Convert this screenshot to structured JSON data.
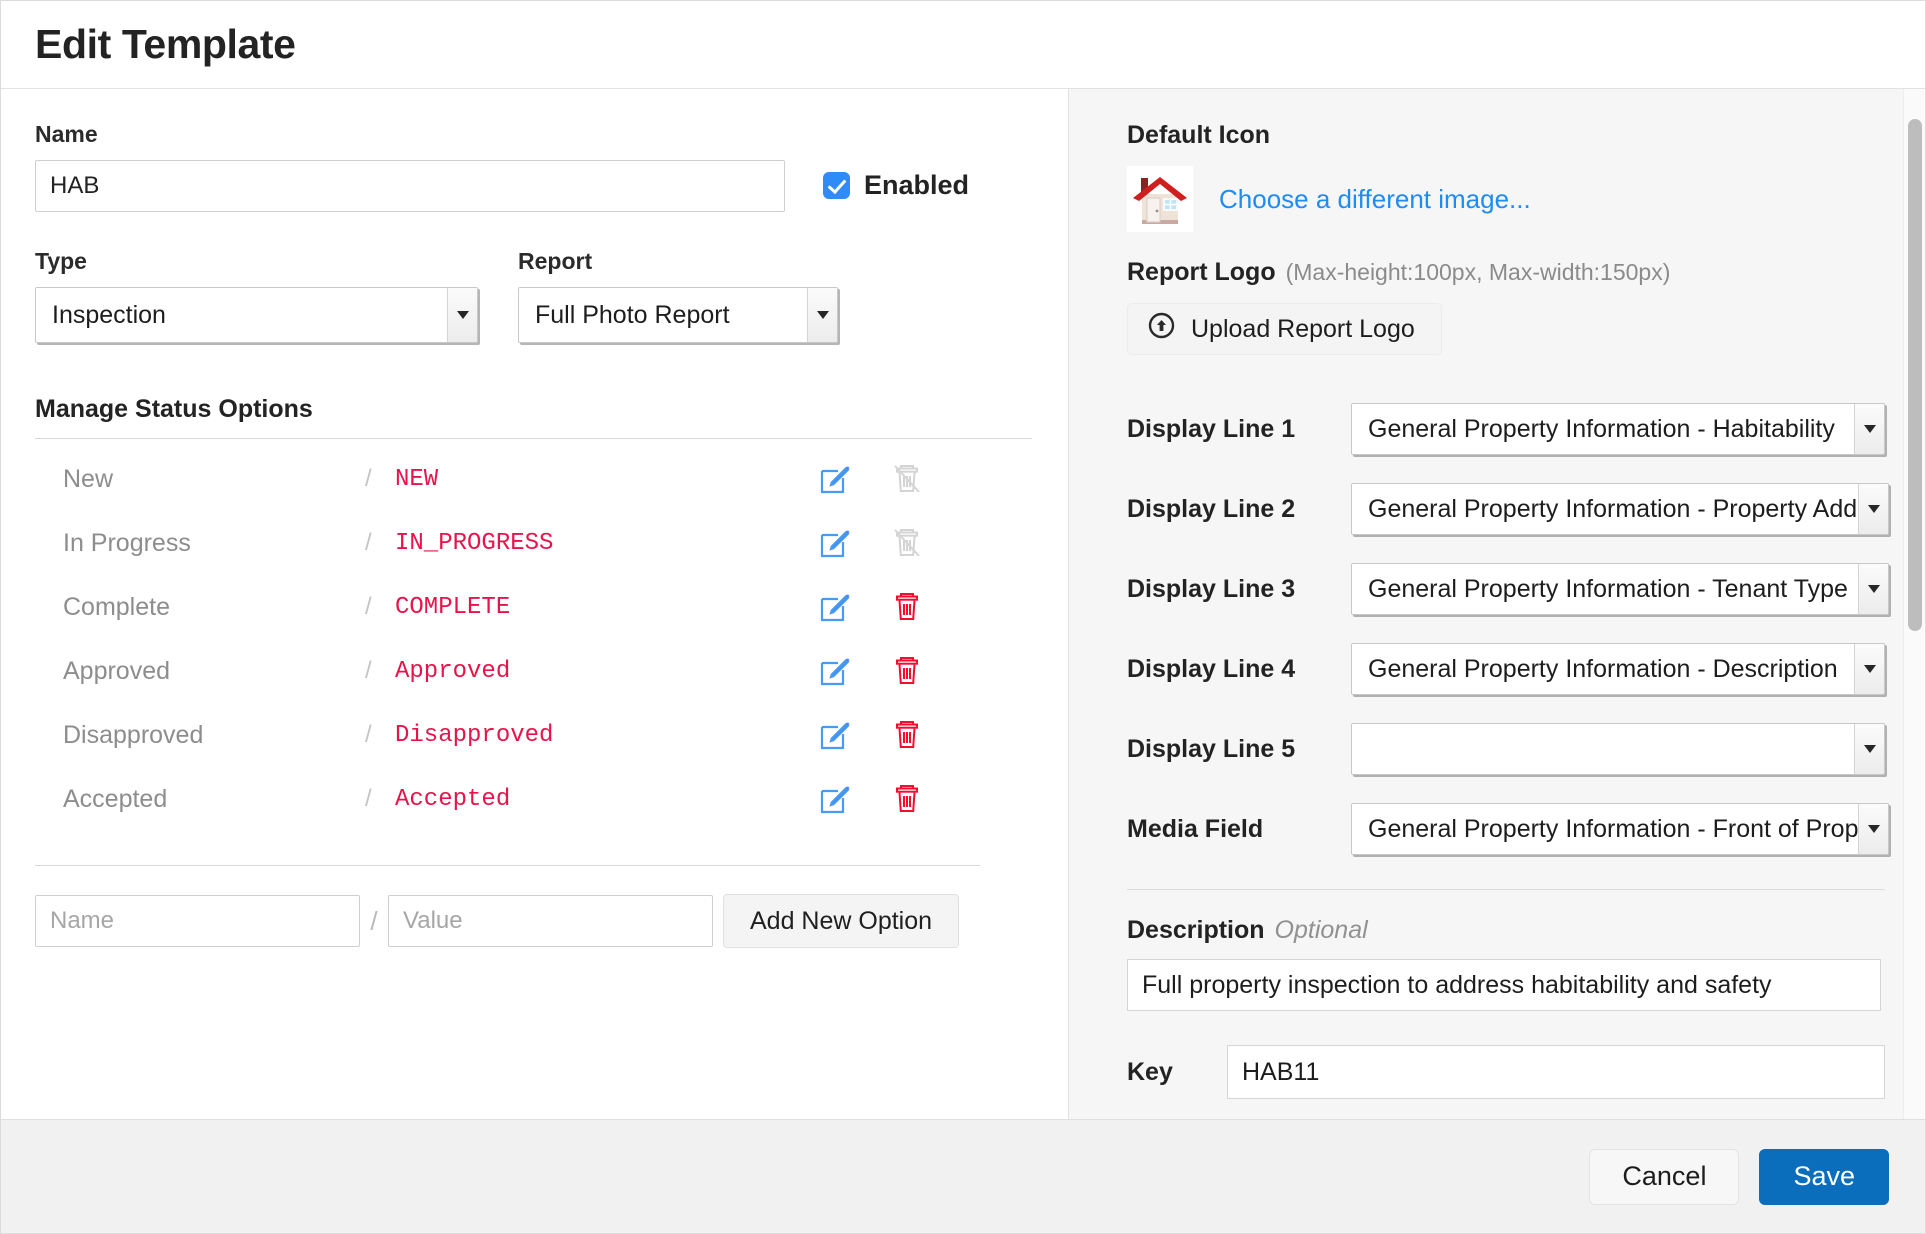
{
  "header": {
    "title": "Edit Template"
  },
  "left": {
    "name_label": "Name",
    "name_value": "HAB",
    "enabled_label": "Enabled",
    "enabled_checked": true,
    "type_label": "Type",
    "type_value": "Inspection",
    "report_label": "Report",
    "report_value": "Full Photo Report",
    "section_title": "Manage Status Options",
    "status_options": [
      {
        "name": "New",
        "separator": "/",
        "value": "NEW",
        "edit_icon": "edit-pencil-icon",
        "delete_icon": "trash-disabled-icon",
        "deletable": false
      },
      {
        "name": "In Progress",
        "separator": "/",
        "value": "IN_PROGRESS",
        "edit_icon": "edit-pencil-icon",
        "delete_icon": "trash-disabled-icon",
        "deletable": false
      },
      {
        "name": "Complete",
        "separator": "/",
        "value": "COMPLETE",
        "edit_icon": "edit-pencil-icon",
        "delete_icon": "trash-icon",
        "deletable": true
      },
      {
        "name": "Approved",
        "separator": "/",
        "value": "Approved",
        "edit_icon": "edit-pencil-icon",
        "delete_icon": "trash-icon",
        "deletable": true
      },
      {
        "name": "Disapproved",
        "separator": "/",
        "value": "Disapproved",
        "edit_icon": "edit-pencil-icon",
        "delete_icon": "trash-icon",
        "deletable": true
      },
      {
        "name": "Accepted",
        "separator": "/",
        "value": "Accepted",
        "edit_icon": "edit-pencil-icon",
        "delete_icon": "trash-icon",
        "deletable": true
      }
    ],
    "add_new": {
      "name_placeholder": "Name",
      "separator": "/",
      "value_placeholder": "Value",
      "button_label": "Add New Option"
    }
  },
  "right": {
    "default_icon_label": "Default Icon",
    "default_icon": "house-icon",
    "choose_image_link": "Choose a different image...",
    "report_logo_label": "Report Logo",
    "report_logo_hint": "(Max-height:100px, Max-width:150px)",
    "upload_button_label": "Upload Report Logo",
    "upload_icon": "upload-circle-icon",
    "display_lines": [
      {
        "label": "Display Line 1",
        "value": "General Property Information - Habitability"
      },
      {
        "label": "Display Line 2",
        "value": "General Property Information - Property Address"
      },
      {
        "label": "Display Line 3",
        "value": "General Property Information - Tenant Type"
      },
      {
        "label": "Display Line 4",
        "value": "General Property Information - Description"
      },
      {
        "label": "Display Line 5",
        "value": ""
      },
      {
        "label": "Media Field",
        "value": "General Property Information - Front of Property"
      }
    ],
    "description_label": "Description",
    "description_optional": "Optional",
    "description_value": "Full property inspection to address habitability and safety",
    "key_label": "Key",
    "key_value": "HAB11"
  },
  "footer": {
    "cancel_label": "Cancel",
    "save_label": "Save"
  },
  "colors": {
    "accent": "#0a6ebd",
    "checkbox": "#2f8bf7",
    "status_value": "#e8134b",
    "link": "#1f8bf5",
    "delete": "#fb0b2e"
  }
}
